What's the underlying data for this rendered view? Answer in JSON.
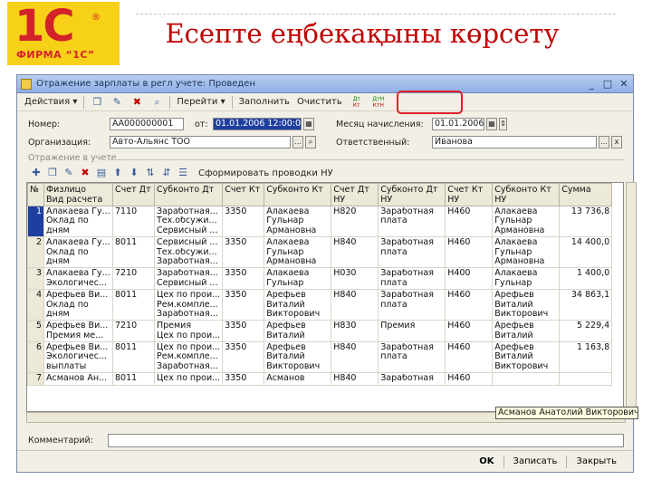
{
  "slide": {
    "title": "Есепте еңбекақыны көрсету",
    "logo_main": "1С",
    "logo_sub": "ФИРМА “1С”",
    "logo_reg": "®"
  },
  "window": {
    "title": "Отражение зарплаты в регл учете: Проведен",
    "minimize_icon": "minimize-icon",
    "maximize_icon": "maximize-icon",
    "close_icon": "close-icon"
  },
  "toolbar": {
    "actions_label": "Действия ▾",
    "goto_label": "Перейти ▾",
    "fill_label": "Заполнить",
    "clear_label": "Очистить",
    "dt_label": "Дт",
    "kt_label": "Кт",
    "dtn_label": "ДтН",
    "ktn_label": "КтН"
  },
  "form": {
    "number_label": "Номер:",
    "number_value": "АА000000001",
    "from_label": "от:",
    "date_value": "01.01.2006 12:00:04",
    "month_label": "Месяц начисления:",
    "month_value": "01.01.2006",
    "org_label": "Организация:",
    "org_value": "Авто-Альянс ТОО",
    "resp_label": "Ответственный:",
    "resp_value": "Иванова",
    "pick_glyph": "...",
    "clear_glyph": "x"
  },
  "section": {
    "title": "Отражение в учете",
    "form_nu_label": "Сформировать проводки НУ"
  },
  "table": {
    "columns": [
      "№",
      "Физлицо\nВид расчета",
      "Счет Дт",
      "Субконто Дт",
      "Счет Кт",
      "Субконто Кт",
      "Счет Дт\nНУ",
      "Субконто Дт\nНУ",
      "Счет Кт\nНУ",
      "Субконто Кт\nНУ",
      "Сумма"
    ],
    "rows": [
      {
        "no": "1",
        "person": [
          "Алакаева Гу...",
          "Оклад по",
          "дням"
        ],
        "dt": "7110",
        "sub_dt": [
          "Заработная...",
          "Тех.обсужи...",
          "Сервисный ..."
        ],
        "kt": "3350",
        "sub_kt": [
          "Алакаева",
          "Гульнар",
          "Армановна"
        ],
        "dt_nu": "Н820",
        "sub_dt_nu": [
          "Заработная",
          "плата"
        ],
        "kt_nu": "Н460",
        "sub_kt_nu": [
          "Алакаева",
          "Гульнар",
          "Армановна"
        ],
        "sum": "13 736,8"
      },
      {
        "no": "2",
        "person": [
          "Алакаева Гу...",
          "Оклад по",
          "дням"
        ],
        "dt": "8011",
        "sub_dt": [
          "Сервисный ...",
          "Тех.обсужи...",
          "Заработная..."
        ],
        "kt": "3350",
        "sub_kt": [
          "Алакаева",
          "Гульнар",
          "Армановна"
        ],
        "dt_nu": "Н840",
        "sub_dt_nu": [
          "Заработная",
          "плата"
        ],
        "kt_nu": "Н460",
        "sub_kt_nu": [
          "Алакаева",
          "Гульнар",
          "Армановна"
        ],
        "sum": "14 400,0"
      },
      {
        "no": "3",
        "person": [
          "Алакаева Гу...",
          "Экологичес..."
        ],
        "dt": "7210",
        "sub_dt": [
          "Заработная...",
          "Сервисный ..."
        ],
        "kt": "3350",
        "sub_kt": [
          "Алакаева",
          "Гульнар"
        ],
        "dt_nu": "Н030",
        "sub_dt_nu": [
          "Заработная",
          "плата"
        ],
        "kt_nu": "Н400",
        "sub_kt_nu": [
          "Алакаева",
          "Гульнар"
        ],
        "sum": "1 400,0"
      },
      {
        "no": "4",
        "person": [
          "Арефьев Ви...",
          "Оклад по",
          "дням"
        ],
        "dt": "8011",
        "sub_dt": [
          "Цех по прои...",
          "Рем.компле...",
          "Заработная..."
        ],
        "kt": "3350",
        "sub_kt": [
          "Арефьев",
          "Виталий",
          "Викторович"
        ],
        "dt_nu": "Н840",
        "sub_dt_nu": [
          "Заработная",
          "плата"
        ],
        "kt_nu": "Н460",
        "sub_kt_nu": [
          "Арефьев",
          "Виталий",
          "Викторович"
        ],
        "sum": "34 863,1"
      },
      {
        "no": "5",
        "person": [
          "Арефьев Ви...",
          "Премия ме..."
        ],
        "dt": "7210",
        "sub_dt": [
          "Премия",
          "Цех по прои..."
        ],
        "kt": "3350",
        "sub_kt": [
          "Арефьев",
          "Виталий"
        ],
        "dt_nu": "Н830",
        "sub_dt_nu": [
          "Премия"
        ],
        "kt_nu": "Н460",
        "sub_kt_nu": [
          "Арефьев",
          "Виталий"
        ],
        "sum": "5 229,4"
      },
      {
        "no": "6",
        "person": [
          "Арефьев Ви...",
          "Экологичес...",
          "выплаты"
        ],
        "dt": "8011",
        "sub_dt": [
          "Цех по прои...",
          "Рем.компле...",
          "Заработная..."
        ],
        "kt": "3350",
        "sub_kt": [
          "Арефьев",
          "Виталий",
          "Викторович"
        ],
        "dt_nu": "Н840",
        "sub_dt_nu": [
          "Заработная",
          "плата"
        ],
        "kt_nu": "Н460",
        "sub_kt_nu": [
          "Арефьев",
          "Виталий",
          "Викторович"
        ],
        "sum": "1 163,8"
      },
      {
        "no": "7",
        "person": [
          "Асманов Ан..."
        ],
        "dt": "8011",
        "sub_dt": [
          "Цех по прои..."
        ],
        "kt": "3350",
        "sub_kt": [
          "Асманов"
        ],
        "dt_nu": "Н840",
        "sub_dt_nu": [
          "Заработная"
        ],
        "kt_nu": "Н460",
        "sub_kt_nu": [
          ""
        ],
        "sum": ""
      }
    ]
  },
  "tooltip": "Асманов Анатолий Викторович",
  "comment_label": "Комментарий:",
  "buttons": {
    "ok": "OK",
    "save": "Записать",
    "close": "Закрыть"
  }
}
